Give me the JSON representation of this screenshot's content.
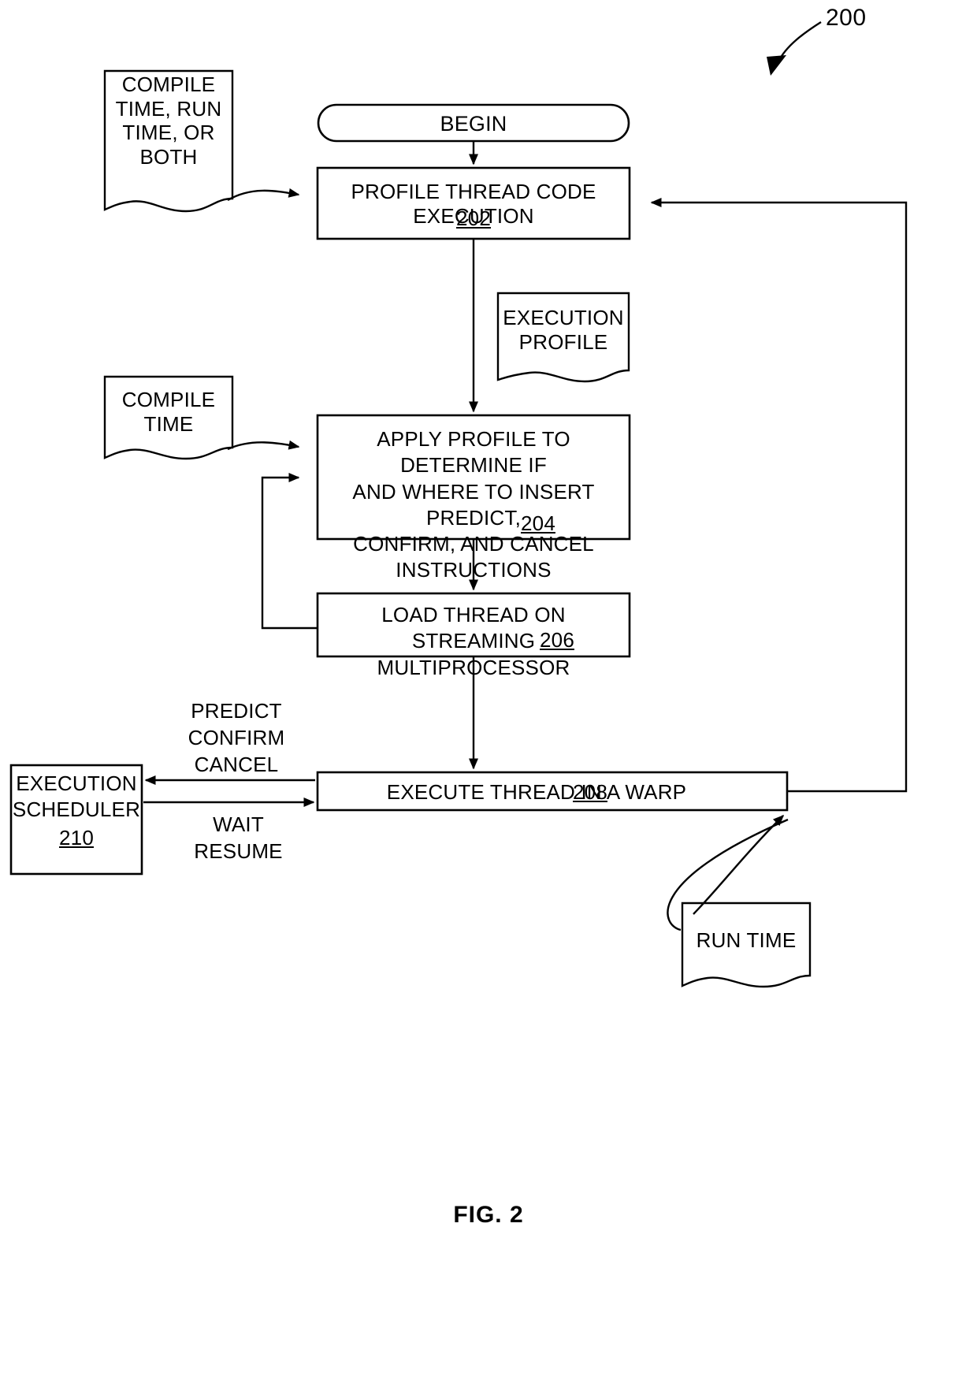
{
  "figure": {
    "caption": "FIG. 2",
    "reference_number": "200"
  },
  "nodes": {
    "begin": {
      "id": "begin",
      "shape": "stadium",
      "label": "BEGIN"
    },
    "doc_compile_run_both": {
      "id": "doc-compile-run-both",
      "shape": "document",
      "label": "COMPILE\nTIME, RUN\nTIME, OR\nBOTH"
    },
    "step202": {
      "id": "profile-thread-code-execution",
      "shape": "process",
      "label": "PROFILE THREAD CODE EXECUTION",
      "number": "202"
    },
    "doc_execution_profile": {
      "id": "doc-execution-profile",
      "shape": "document",
      "label": "EXECUTION\nPROFILE"
    },
    "doc_compile_time": {
      "id": "doc-compile-time",
      "shape": "document",
      "label": "COMPILE\nTIME"
    },
    "step204": {
      "id": "apply-profile-to-determine",
      "shape": "process",
      "label": "APPLY PROFILE TO DETERMINE IF\nAND WHERE TO INSERT PREDICT,\nCONFIRM, AND CANCEL\nINSTRUCTIONS",
      "number": "204"
    },
    "step206": {
      "id": "load-thread-on-streaming-multiprocessor",
      "shape": "process",
      "label": "LOAD THREAD ON STREAMING\nMULTIPROCESSOR",
      "number": "206"
    },
    "step208": {
      "id": "execute-thread-in-a-warp",
      "shape": "process",
      "label": "EXECUTE THREAD IN A WARP",
      "number": "208"
    },
    "step210": {
      "id": "execution-scheduler",
      "shape": "process",
      "label": "EXECUTION\nSCHEDULER",
      "number": "210"
    },
    "doc_run_time": {
      "id": "doc-run-time",
      "shape": "document",
      "label": "RUN TIME"
    }
  },
  "edge_labels": {
    "predict_confirm_cancel": "PREDICT\nCONFIRM\nCANCEL",
    "wait_resume": "WAIT\nRESUME"
  },
  "style": {
    "stroke": "#000000",
    "fill": "#ffffff",
    "background": "#ffffff"
  }
}
